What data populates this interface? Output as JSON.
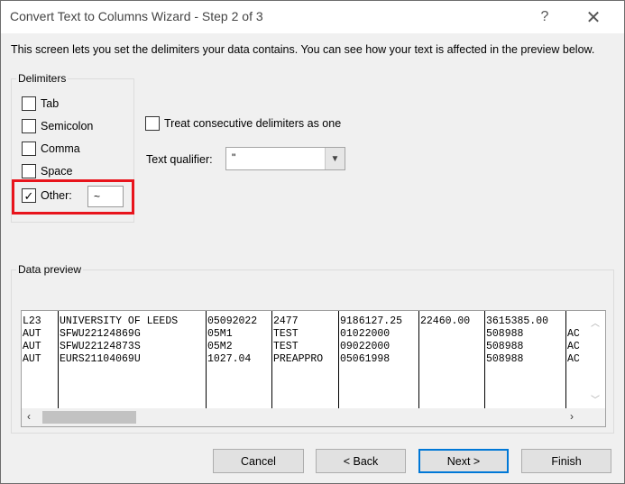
{
  "window": {
    "title": "Convert Text to Columns Wizard - Step 2 of 3",
    "help_label": "?",
    "close_label": "✕"
  },
  "intro_text": "This screen lets you set the delimiters your data contains.  You can see how your text is affected in the preview below.",
  "delimiters": {
    "group_label": "Delimiters",
    "items": [
      {
        "label": "Tab",
        "checked": false
      },
      {
        "label": "Semicolon",
        "checked": false
      },
      {
        "label": "Comma",
        "checked": false
      },
      {
        "label": "Space",
        "checked": false
      },
      {
        "label": "Other:",
        "checked": true
      }
    ],
    "other_value": "~",
    "highlight_color": "#e8141c"
  },
  "consecutive": {
    "label": "Treat consecutive delimiters as one",
    "checked": false
  },
  "qualifier": {
    "label": "Text qualifier:",
    "value": "\"",
    "arrow_icon": "chevron-down-icon"
  },
  "preview": {
    "group_label": "Data preview",
    "columns": [
      [
        "L23",
        "AUT",
        "AUT",
        "AUT"
      ],
      [
        "UNIVERSITY OF LEEDS",
        "SFWU22124869G",
        "SFWU22124873S",
        "EURS21104069U"
      ],
      [
        "05092022",
        "05M1",
        "05M2",
        "1027.04"
      ],
      [
        "2477",
        "TEST",
        "TEST",
        "PREAPPRO"
      ],
      [
        "9186127.25",
        "01022000",
        "09022000",
        "05061998"
      ],
      [
        "22460.00",
        "",
        "",
        ""
      ],
      [
        "3615385.00",
        "508988",
        "508988",
        "508988"
      ],
      [
        "",
        "AC",
        "AC",
        "AC"
      ]
    ]
  },
  "buttons": {
    "cancel": "Cancel",
    "back": "< Back",
    "next": "Next >",
    "finish": "Finish"
  }
}
